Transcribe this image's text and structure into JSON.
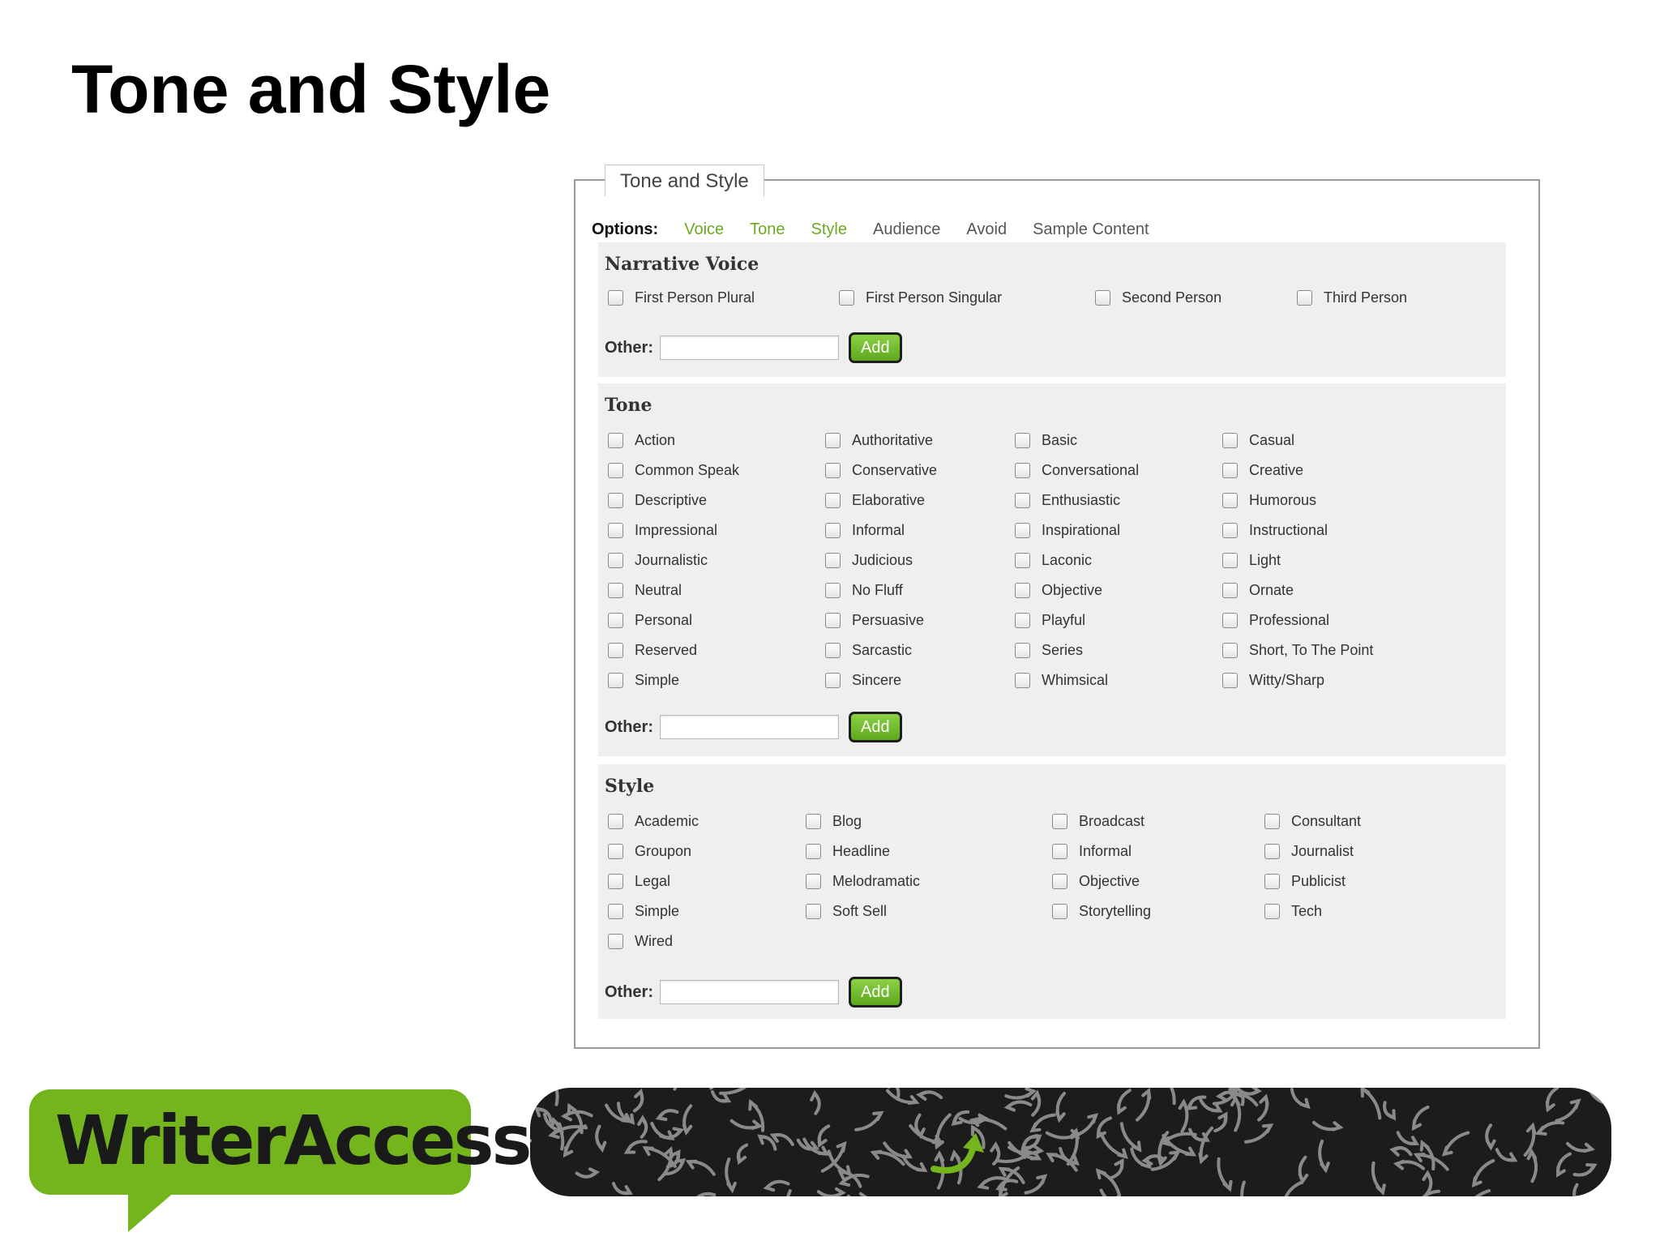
{
  "slide": {
    "title": "Tone and Style"
  },
  "panel": {
    "legend": "Tone and Style",
    "options_label": "Options:",
    "options": [
      {
        "label": "Voice",
        "active": true
      },
      {
        "label": "Tone",
        "active": true
      },
      {
        "label": "Style",
        "active": true
      },
      {
        "label": "Audience",
        "active": false
      },
      {
        "label": "Avoid",
        "active": false
      },
      {
        "label": "Sample Content",
        "active": false
      }
    ]
  },
  "narrative_voice": {
    "heading": "Narrative Voice",
    "items": [
      "First Person Plural",
      "First Person Singular",
      "Second Person",
      "Third Person"
    ],
    "other_label": "Other:",
    "add_label": "Add"
  },
  "tone": {
    "heading": "Tone",
    "items": [
      [
        "Action",
        "Authoritative",
        "Basic",
        "Casual"
      ],
      [
        "Common Speak",
        "Conservative",
        "Conversational",
        "Creative"
      ],
      [
        "Descriptive",
        "Elaborative",
        "Enthusiastic",
        "Humorous"
      ],
      [
        "Impressional",
        "Informal",
        "Inspirational",
        "Instructional"
      ],
      [
        "Journalistic",
        "Judicious",
        "Laconic",
        "Light"
      ],
      [
        "Neutral",
        "No Fluff",
        "Objective",
        "Ornate"
      ],
      [
        "Personal",
        "Persuasive",
        "Playful",
        "Professional"
      ],
      [
        "Reserved",
        "Sarcastic",
        "Series",
        "Short, To The Point"
      ],
      [
        "Simple",
        "Sincere",
        "Whimsical",
        "Witty/Sharp"
      ]
    ],
    "other_label": "Other:",
    "add_label": "Add"
  },
  "style": {
    "heading": "Style",
    "items": [
      [
        "Academic",
        "Blog",
        "Broadcast",
        "Consultant"
      ],
      [
        "Groupon",
        "Headline",
        "Informal",
        "Journalist"
      ],
      [
        "Legal",
        "Melodramatic",
        "Objective",
        "Publicist"
      ],
      [
        "Simple",
        "Soft Sell",
        "Storytelling",
        "Tech"
      ],
      [
        "Wired"
      ]
    ],
    "other_label": "Other:",
    "add_label": "Add"
  },
  "logo": {
    "text": "WriterAccess"
  },
  "colors": {
    "accent_green": "#6aaa1e",
    "button_green": "#5ea81c",
    "logo_green": "#74b51e"
  },
  "icons": {
    "banner": "arrow-pattern-banner",
    "banner_center": "curved-arrow-icon"
  }
}
